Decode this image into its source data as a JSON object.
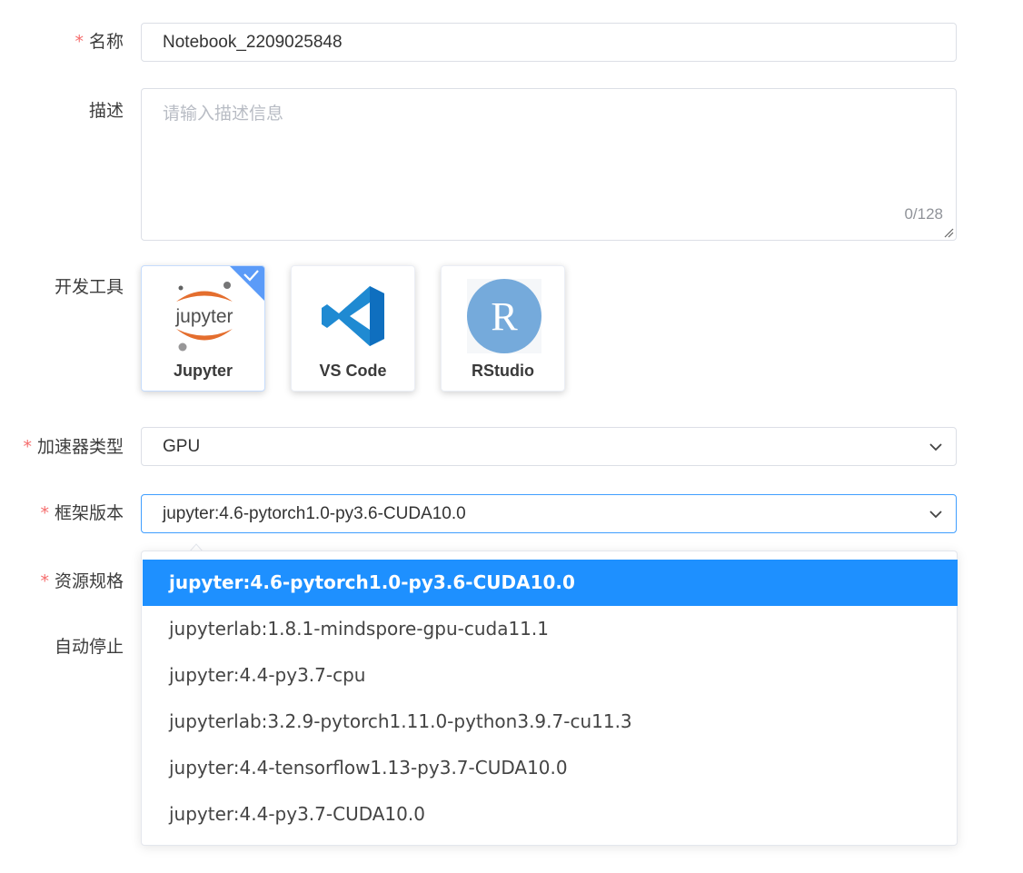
{
  "form": {
    "name": {
      "label": "名称",
      "required_mark": "*",
      "value": "Notebook_2209025848"
    },
    "description": {
      "label": "描述",
      "placeholder": "请输入描述信息",
      "counter": "0/128"
    },
    "dev_tools": {
      "label": "开发工具",
      "selected": "Jupyter",
      "items": [
        {
          "name": "Jupyter",
          "icon": "jupyter-logo-icon",
          "logo_text": "jupyter"
        },
        {
          "name": "VS Code",
          "icon": "vscode-logo-icon"
        },
        {
          "name": "RStudio",
          "icon": "rstudio-logo-icon",
          "logo_text": "R"
        }
      ]
    },
    "accelerator": {
      "label": "加速器类型",
      "required_mark": "*",
      "value": "GPU"
    },
    "framework": {
      "label": "框架版本",
      "required_mark": "*",
      "value": "jupyter:4.6-pytorch1.0-py3.6-CUDA10.0",
      "options": [
        "jupyter:4.6-pytorch1.0-py3.6-CUDA10.0",
        "jupyterlab:1.8.1-mindspore-gpu-cuda11.1",
        "jupyter:4.4-py3.7-cpu",
        "jupyterlab:3.2.9-pytorch1.11.0-python3.9.7-cu11.3",
        "jupyter:4.4-tensorflow1.13-py3.7-CUDA10.0",
        "jupyter:4.4-py3.7-CUDA10.0"
      ]
    },
    "resource_spec": {
      "label": "资源规格",
      "required_mark": "*"
    },
    "auto_stop": {
      "label": "自动停止"
    }
  },
  "colors": {
    "primary": "#409eff",
    "selected_option": "#1e90ff",
    "required": "#f56c6c"
  }
}
